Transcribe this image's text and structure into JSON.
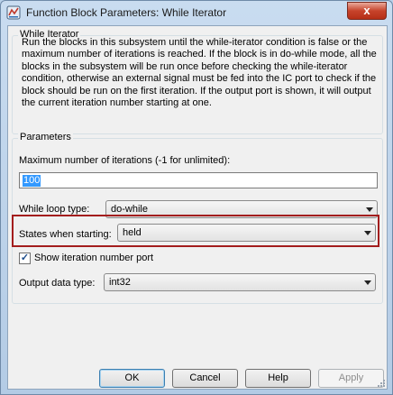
{
  "window": {
    "title": "Function Block Parameters: While Iterator",
    "close_glyph": "x"
  },
  "block_group": {
    "title": "While Iterator",
    "description": "Run the blocks in this subsystem until the while-iterator condition is false or the maximum number of iterations is reached.  If the block is in do-while mode, all the blocks in the subsystem will be run once before checking the while-iterator condition, otherwise an external signal must be fed into the IC port to check if the block should be run on the first iteration.  If the output port is shown, it will output the current iteration number starting at one."
  },
  "parameters": {
    "title": "Parameters",
    "max_iterations_label": "Maximum number of iterations (-1 for unlimited):",
    "max_iterations_value": "100",
    "while_loop_type_label": "While loop type:",
    "while_loop_type_value": "do-while",
    "states_label": "States when starting:",
    "states_value": "held",
    "show_iteration_label": "Show iteration number port",
    "show_iteration_checked": true,
    "output_type_label": "Output data type:",
    "output_type_value": "int32"
  },
  "buttons": {
    "ok": "OK",
    "cancel": "Cancel",
    "help": "Help",
    "apply": "Apply"
  },
  "colors": {
    "highlight_border": "#a31d1d",
    "selection": "#3399ff"
  }
}
